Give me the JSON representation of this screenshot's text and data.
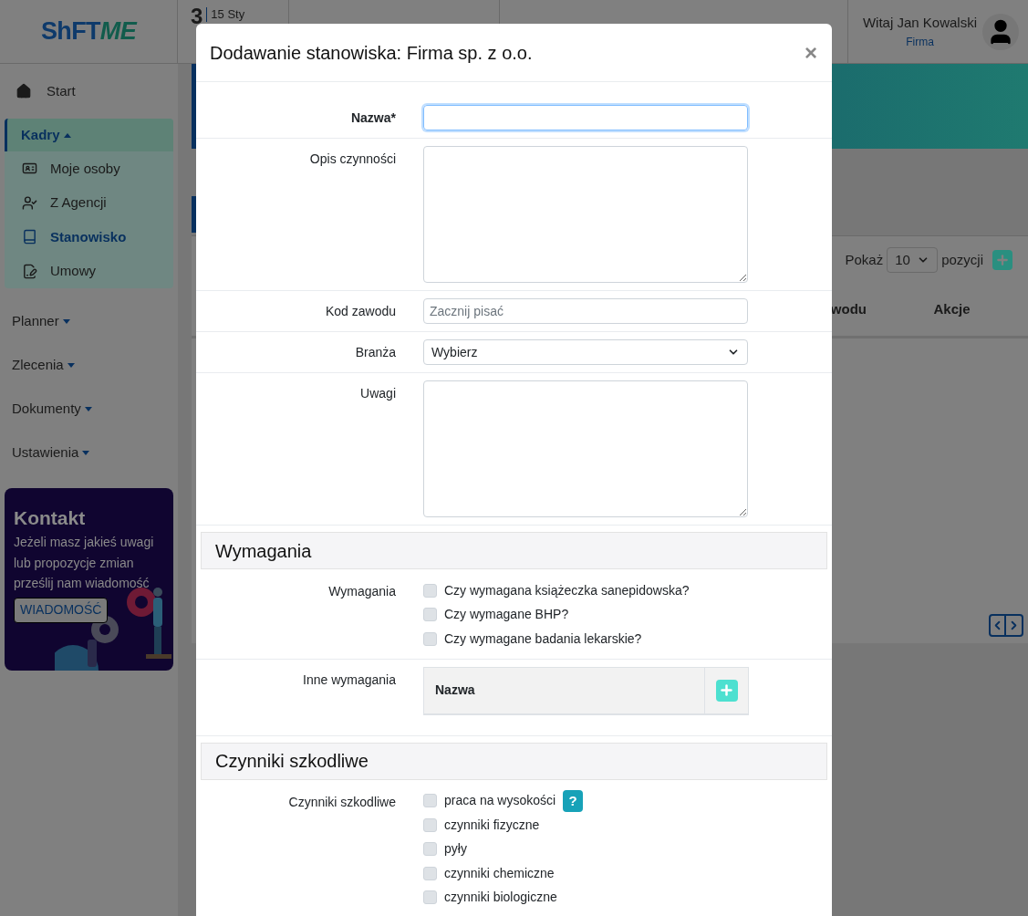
{
  "brand": {
    "logo_left": "ShFT",
    "logo_right": "ME"
  },
  "header": {
    "day": "3",
    "date": "15 Sty",
    "greeting": "Witaj Jan Kowalski",
    "company": "Firma"
  },
  "sidebar": {
    "items": [
      {
        "label": "Start",
        "kind": "link"
      },
      {
        "label": "Kadry",
        "kind": "group",
        "expanded": true,
        "children": [
          {
            "label": "Moje osoby",
            "selected": false
          },
          {
            "label": "Z Agencji",
            "selected": false
          },
          {
            "label": "Stanowisko",
            "selected": true
          },
          {
            "label": "Umowy",
            "selected": false
          }
        ]
      },
      {
        "label": "Planner",
        "kind": "group",
        "expanded": false
      },
      {
        "label": "Zlecenia",
        "kind": "group",
        "expanded": false
      },
      {
        "label": "Dokumenty",
        "kind": "group",
        "expanded": false
      },
      {
        "label": "Ustawienia",
        "kind": "group",
        "expanded": false
      }
    ]
  },
  "contact": {
    "title": "Kontakt",
    "text": "Jeżeli masz jakieś uwagi lub propozycje zmian prześlij nam wiadomość",
    "button": "WIADOMOŚĆ"
  },
  "list_toolbar": {
    "show_label": "Pokaż",
    "page_size": "10",
    "suffix": "pozycji"
  },
  "table": {
    "columns": [
      "wodu",
      "Akcje"
    ]
  },
  "modal": {
    "title": "Dodawanie stanowiska: Firma sp. z o.o.",
    "close": "×",
    "fields": [
      {
        "kind": "text",
        "label": "Nazwa*",
        "required": true,
        "focused": true
      },
      {
        "kind": "textarea",
        "label": "Opis czynności",
        "required": false,
        "focused": false
      },
      {
        "kind": "text",
        "label": "Kod zawodu",
        "placeholder": "Zacznij pisać",
        "required": false,
        "focused": false
      },
      {
        "kind": "select",
        "label": "Branża",
        "value": "Wybierz",
        "required": false,
        "focused": false
      },
      {
        "kind": "textarea",
        "label": "Uwagi",
        "required": false,
        "focused": false
      }
    ],
    "sections": [
      {
        "title": "Wymagania",
        "rows": [
          {
            "kind": "checkboxes",
            "label": "Wymagania",
            "options": [
              {
                "label": "Czy wymagana książeczka sanepidowska?",
                "checked": false
              },
              {
                "label": "Czy wymagane BHP?",
                "checked": false
              },
              {
                "label": "Czy wymagane badania lekarskie?",
                "checked": false
              }
            ]
          },
          {
            "kind": "table",
            "label": "Inne wymagania",
            "column": "Nazwa"
          }
        ]
      },
      {
        "title": "Czynniki szkodliwe",
        "rows": [
          {
            "kind": "checkboxes",
            "label": "Czynniki szkodliwe",
            "options": [
              {
                "label": "praca na wysokości",
                "checked": false,
                "help": "?"
              },
              {
                "label": "czynniki fizyczne",
                "checked": false
              },
              {
                "label": "pyły",
                "checked": false
              },
              {
                "label": "czynniki chemiczne",
                "checked": false
              },
              {
                "label": "czynniki biologiczne",
                "checked": false
              }
            ]
          }
        ]
      }
    ]
  }
}
